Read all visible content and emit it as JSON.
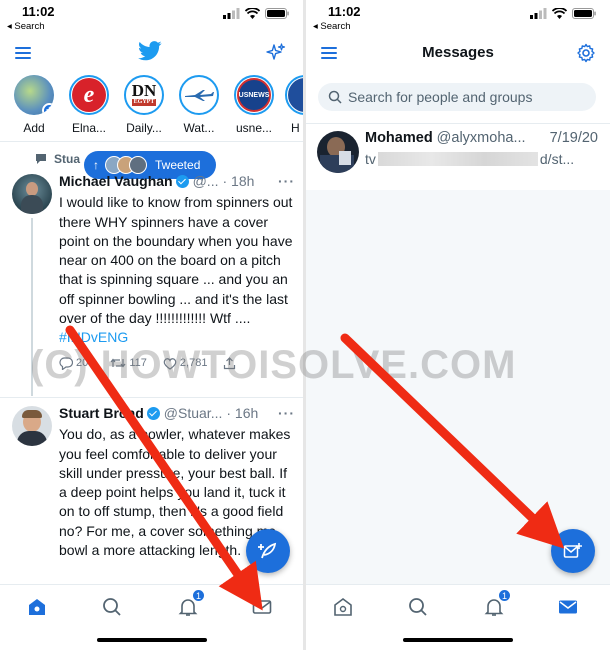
{
  "status_bar": {
    "time": "11:02",
    "back_label": "◂ Search"
  },
  "home": {
    "fleets": [
      {
        "label": "Add",
        "icon": "add-fleet-avatar"
      },
      {
        "label": "Elna...",
        "icon": "e-logo"
      },
      {
        "label": "Daily...",
        "icon": "dn-logo"
      },
      {
        "label": "Wat...",
        "icon": "plane-logo"
      },
      {
        "label": "usne...",
        "icon": "usnews-logo"
      },
      {
        "label": "H",
        "icon": "partial-avatar"
      }
    ],
    "social_context": "Stua",
    "tweeted_pill": {
      "arrow": "↑",
      "label": "Tweeted"
    },
    "tweets": [
      {
        "name": "Michael Vaughan",
        "handle": "@...",
        "time": "· 18h",
        "more": "···",
        "text": "I would like to know from spinners out there WHY spinners have a cover point on the boundary when you have near on 400 on the board on a pitch that is spinning square ... and you an off spinner bowling ... and it's the last over of the day !!!!!!!!!!!!! Wtf ....",
        "hashtag": "#INDvENG",
        "replies": "207",
        "retweets": "117",
        "likes": "2,781"
      },
      {
        "name": "Stuart Broad",
        "handle": "@Stuar...",
        "time": "· 16h",
        "more": "···",
        "text": "You do, as a bowler, whatever makes you feel comfortable to deliver your skill under pressure, your best ball. If a deep point helps you land it, tuck it on to off stump, then it's a good field no? For me, a cover something me bowl a more attacking length."
      }
    ],
    "notification_count": "1"
  },
  "messages": {
    "title": "Messages",
    "search_placeholder": "Search for people and groups",
    "conversation": {
      "name": "Mohamed",
      "handle": "@alyxmoha...",
      "date": "7/19/20",
      "preview_start": "tv",
      "preview_end": "d/st..."
    },
    "notification_count": "1"
  },
  "watermark": "(C) HOWTOISOLVE.COM",
  "colors": {
    "accent": "#1d6fdb",
    "twitter_blue": "#1d9bf0",
    "arrow_red": "#ef2b14"
  }
}
